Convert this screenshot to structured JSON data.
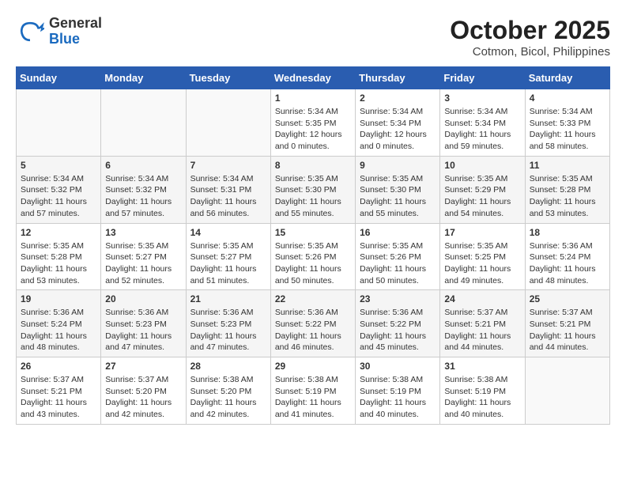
{
  "logo": {
    "general": "General",
    "blue": "Blue"
  },
  "title": "October 2025",
  "subtitle": "Cotmon, Bicol, Philippines",
  "weekdays": [
    "Sunday",
    "Monday",
    "Tuesday",
    "Wednesday",
    "Thursday",
    "Friday",
    "Saturday"
  ],
  "weeks": [
    [
      {
        "day": "",
        "info": ""
      },
      {
        "day": "",
        "info": ""
      },
      {
        "day": "",
        "info": ""
      },
      {
        "day": "1",
        "info": "Sunrise: 5:34 AM\nSunset: 5:35 PM\nDaylight: 12 hours\nand 0 minutes."
      },
      {
        "day": "2",
        "info": "Sunrise: 5:34 AM\nSunset: 5:34 PM\nDaylight: 12 hours\nand 0 minutes."
      },
      {
        "day": "3",
        "info": "Sunrise: 5:34 AM\nSunset: 5:34 PM\nDaylight: 11 hours\nand 59 minutes."
      },
      {
        "day": "4",
        "info": "Sunrise: 5:34 AM\nSunset: 5:33 PM\nDaylight: 11 hours\nand 58 minutes."
      }
    ],
    [
      {
        "day": "5",
        "info": "Sunrise: 5:34 AM\nSunset: 5:32 PM\nDaylight: 11 hours\nand 57 minutes."
      },
      {
        "day": "6",
        "info": "Sunrise: 5:34 AM\nSunset: 5:32 PM\nDaylight: 11 hours\nand 57 minutes."
      },
      {
        "day": "7",
        "info": "Sunrise: 5:34 AM\nSunset: 5:31 PM\nDaylight: 11 hours\nand 56 minutes."
      },
      {
        "day": "8",
        "info": "Sunrise: 5:35 AM\nSunset: 5:30 PM\nDaylight: 11 hours\nand 55 minutes."
      },
      {
        "day": "9",
        "info": "Sunrise: 5:35 AM\nSunset: 5:30 PM\nDaylight: 11 hours\nand 55 minutes."
      },
      {
        "day": "10",
        "info": "Sunrise: 5:35 AM\nSunset: 5:29 PM\nDaylight: 11 hours\nand 54 minutes."
      },
      {
        "day": "11",
        "info": "Sunrise: 5:35 AM\nSunset: 5:28 PM\nDaylight: 11 hours\nand 53 minutes."
      }
    ],
    [
      {
        "day": "12",
        "info": "Sunrise: 5:35 AM\nSunset: 5:28 PM\nDaylight: 11 hours\nand 53 minutes."
      },
      {
        "day": "13",
        "info": "Sunrise: 5:35 AM\nSunset: 5:27 PM\nDaylight: 11 hours\nand 52 minutes."
      },
      {
        "day": "14",
        "info": "Sunrise: 5:35 AM\nSunset: 5:27 PM\nDaylight: 11 hours\nand 51 minutes."
      },
      {
        "day": "15",
        "info": "Sunrise: 5:35 AM\nSunset: 5:26 PM\nDaylight: 11 hours\nand 50 minutes."
      },
      {
        "day": "16",
        "info": "Sunrise: 5:35 AM\nSunset: 5:26 PM\nDaylight: 11 hours\nand 50 minutes."
      },
      {
        "day": "17",
        "info": "Sunrise: 5:35 AM\nSunset: 5:25 PM\nDaylight: 11 hours\nand 49 minutes."
      },
      {
        "day": "18",
        "info": "Sunrise: 5:36 AM\nSunset: 5:24 PM\nDaylight: 11 hours\nand 48 minutes."
      }
    ],
    [
      {
        "day": "19",
        "info": "Sunrise: 5:36 AM\nSunset: 5:24 PM\nDaylight: 11 hours\nand 48 minutes."
      },
      {
        "day": "20",
        "info": "Sunrise: 5:36 AM\nSunset: 5:23 PM\nDaylight: 11 hours\nand 47 minutes."
      },
      {
        "day": "21",
        "info": "Sunrise: 5:36 AM\nSunset: 5:23 PM\nDaylight: 11 hours\nand 47 minutes."
      },
      {
        "day": "22",
        "info": "Sunrise: 5:36 AM\nSunset: 5:22 PM\nDaylight: 11 hours\nand 46 minutes."
      },
      {
        "day": "23",
        "info": "Sunrise: 5:36 AM\nSunset: 5:22 PM\nDaylight: 11 hours\nand 45 minutes."
      },
      {
        "day": "24",
        "info": "Sunrise: 5:37 AM\nSunset: 5:21 PM\nDaylight: 11 hours\nand 44 minutes."
      },
      {
        "day": "25",
        "info": "Sunrise: 5:37 AM\nSunset: 5:21 PM\nDaylight: 11 hours\nand 44 minutes."
      }
    ],
    [
      {
        "day": "26",
        "info": "Sunrise: 5:37 AM\nSunset: 5:21 PM\nDaylight: 11 hours\nand 43 minutes."
      },
      {
        "day": "27",
        "info": "Sunrise: 5:37 AM\nSunset: 5:20 PM\nDaylight: 11 hours\nand 42 minutes."
      },
      {
        "day": "28",
        "info": "Sunrise: 5:38 AM\nSunset: 5:20 PM\nDaylight: 11 hours\nand 42 minutes."
      },
      {
        "day": "29",
        "info": "Sunrise: 5:38 AM\nSunset: 5:19 PM\nDaylight: 11 hours\nand 41 minutes."
      },
      {
        "day": "30",
        "info": "Sunrise: 5:38 AM\nSunset: 5:19 PM\nDaylight: 11 hours\nand 40 minutes."
      },
      {
        "day": "31",
        "info": "Sunrise: 5:38 AM\nSunset: 5:19 PM\nDaylight: 11 hours\nand 40 minutes."
      },
      {
        "day": "",
        "info": ""
      }
    ]
  ]
}
